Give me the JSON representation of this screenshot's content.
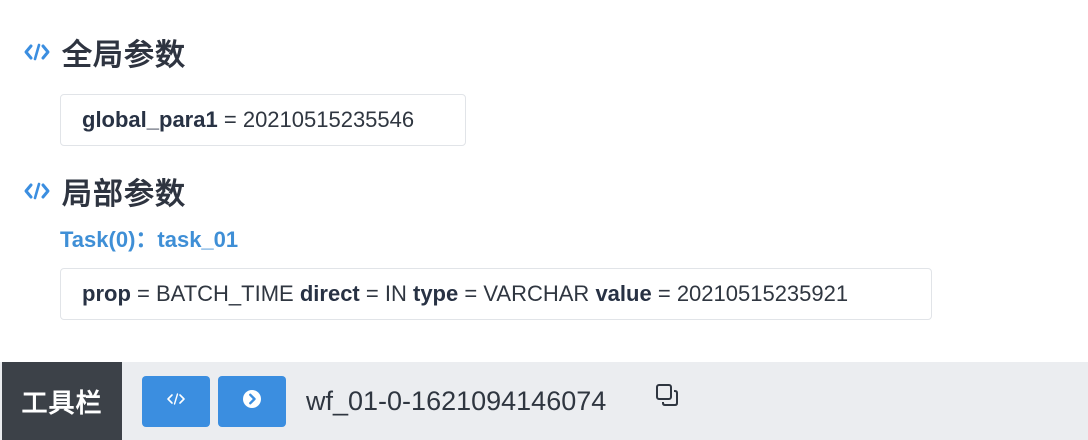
{
  "global_section": {
    "title": "全局参数",
    "icon": "code-icon",
    "params": [
      {
        "name": "global_para1",
        "equals": "=",
        "value": "20210515235546"
      }
    ]
  },
  "local_section": {
    "title": "局部参数",
    "icon": "code-icon",
    "task_label": "Task(0)：task_01",
    "param": {
      "prop_key": "prop",
      "prop_value": "BATCH_TIME",
      "direct_key": "direct",
      "direct_value": "IN",
      "type_key": "type",
      "type_value": "VARCHAR",
      "value_key": "value",
      "value_value": "20210515235921",
      "equals": "="
    }
  },
  "toolbar": {
    "title": "工具栏",
    "buttons": [
      {
        "icon": "code-icon"
      },
      {
        "icon": "chevron-right-circle-icon"
      }
    ],
    "workflow_id": "wf_01-0-1621094146074",
    "copy_icon": "copy-icon"
  },
  "colors": {
    "accent": "#3b8ee0",
    "task_label": "#3f8fd6",
    "toolbar_bg": "#ebedf0",
    "toolbar_title_bg": "#3c4148"
  }
}
